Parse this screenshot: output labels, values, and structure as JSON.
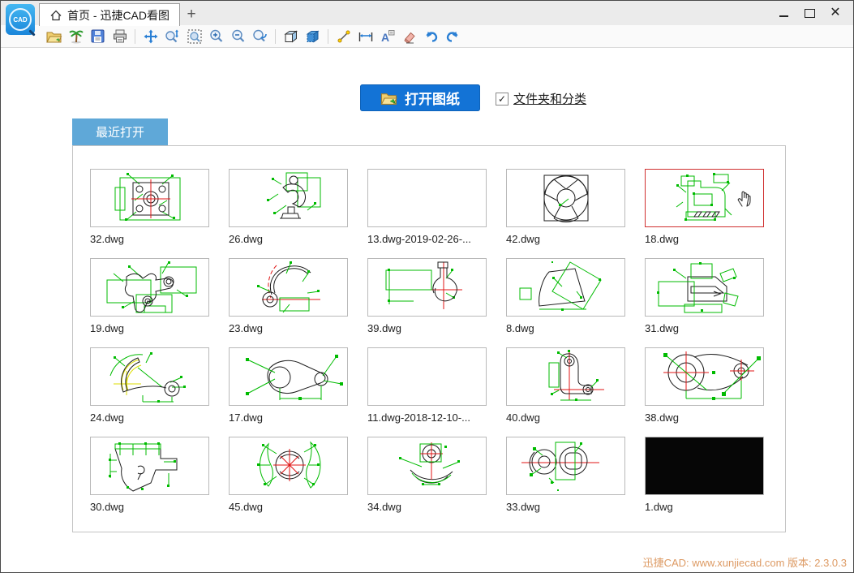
{
  "window": {
    "tab_title": "首页 - 迅捷CAD看图",
    "new_tab_label": "+",
    "controls": [
      "minimize-icon",
      "maximize-icon",
      "close-icon"
    ],
    "logo_text": "CAD"
  },
  "toolbar": {
    "icons": [
      "open-folder-icon",
      "image-browse-icon",
      "save-icon",
      "print-icon",
      "pan-icon",
      "zoom-dynamic-icon",
      "zoom-window-icon",
      "zoom-in-icon",
      "zoom-out-icon",
      "zoom-previous-icon",
      "view-3d-wireframe-icon",
      "view-3d-solid-icon",
      "line-tool-icon",
      "measure-icon",
      "text-tool-icon",
      "eraser-icon",
      "undo-icon",
      "redo-icon"
    ]
  },
  "main": {
    "open_button_label": "打开图纸",
    "checkbox_checked": "✓",
    "checkbox_label": "文件夹和分类",
    "recent_tab_label": "最近打开"
  },
  "thumbnails": [
    {
      "label": "32.dwg",
      "sketch": "sk32",
      "state": "normal"
    },
    {
      "label": "26.dwg",
      "sketch": "sk26",
      "state": "normal"
    },
    {
      "label": "13.dwg-2019-02-26-...",
      "sketch": "empty",
      "state": "normal"
    },
    {
      "label": "42.dwg",
      "sketch": "sk42",
      "state": "normal"
    },
    {
      "label": "18.dwg",
      "sketch": "sk18",
      "state": "highlighted",
      "cursor": true
    },
    {
      "label": "19.dwg",
      "sketch": "sk19",
      "state": "normal"
    },
    {
      "label": "23.dwg",
      "sketch": "sk23",
      "state": "normal"
    },
    {
      "label": "39.dwg",
      "sketch": "sk39",
      "state": "normal"
    },
    {
      "label": "8.dwg",
      "sketch": "sk8",
      "state": "normal"
    },
    {
      "label": "31.dwg",
      "sketch": "sk31",
      "state": "normal"
    },
    {
      "label": "24.dwg",
      "sketch": "sk24",
      "state": "normal"
    },
    {
      "label": "17.dwg",
      "sketch": "sk17",
      "state": "normal"
    },
    {
      "label": "11.dwg-2018-12-10-...",
      "sketch": "empty",
      "state": "normal"
    },
    {
      "label": "40.dwg",
      "sketch": "sk40",
      "state": "normal"
    },
    {
      "label": "38.dwg",
      "sketch": "sk38",
      "state": "normal"
    },
    {
      "label": "30.dwg",
      "sketch": "sk30",
      "state": "normal"
    },
    {
      "label": "45.dwg",
      "sketch": "sk45",
      "state": "normal"
    },
    {
      "label": "34.dwg",
      "sketch": "sk34",
      "state": "normal"
    },
    {
      "label": "33.dwg",
      "sketch": "sk33",
      "state": "normal"
    },
    {
      "label": "1.dwg",
      "sketch": "blackfill",
      "state": "normal"
    }
  ],
  "footer": {
    "text": "迅捷CAD: www.xunjiecad.com 版本: 2.3.0.3"
  },
  "colors": {
    "accent_blue": "#1373d6",
    "tab_blue": "#5fa8d8",
    "highlight_red": "#d03030",
    "cad_green": "#00bb00",
    "cad_red": "#e01414",
    "cad_yellow": "#dede00",
    "footer_orange": "#dd9a63"
  }
}
